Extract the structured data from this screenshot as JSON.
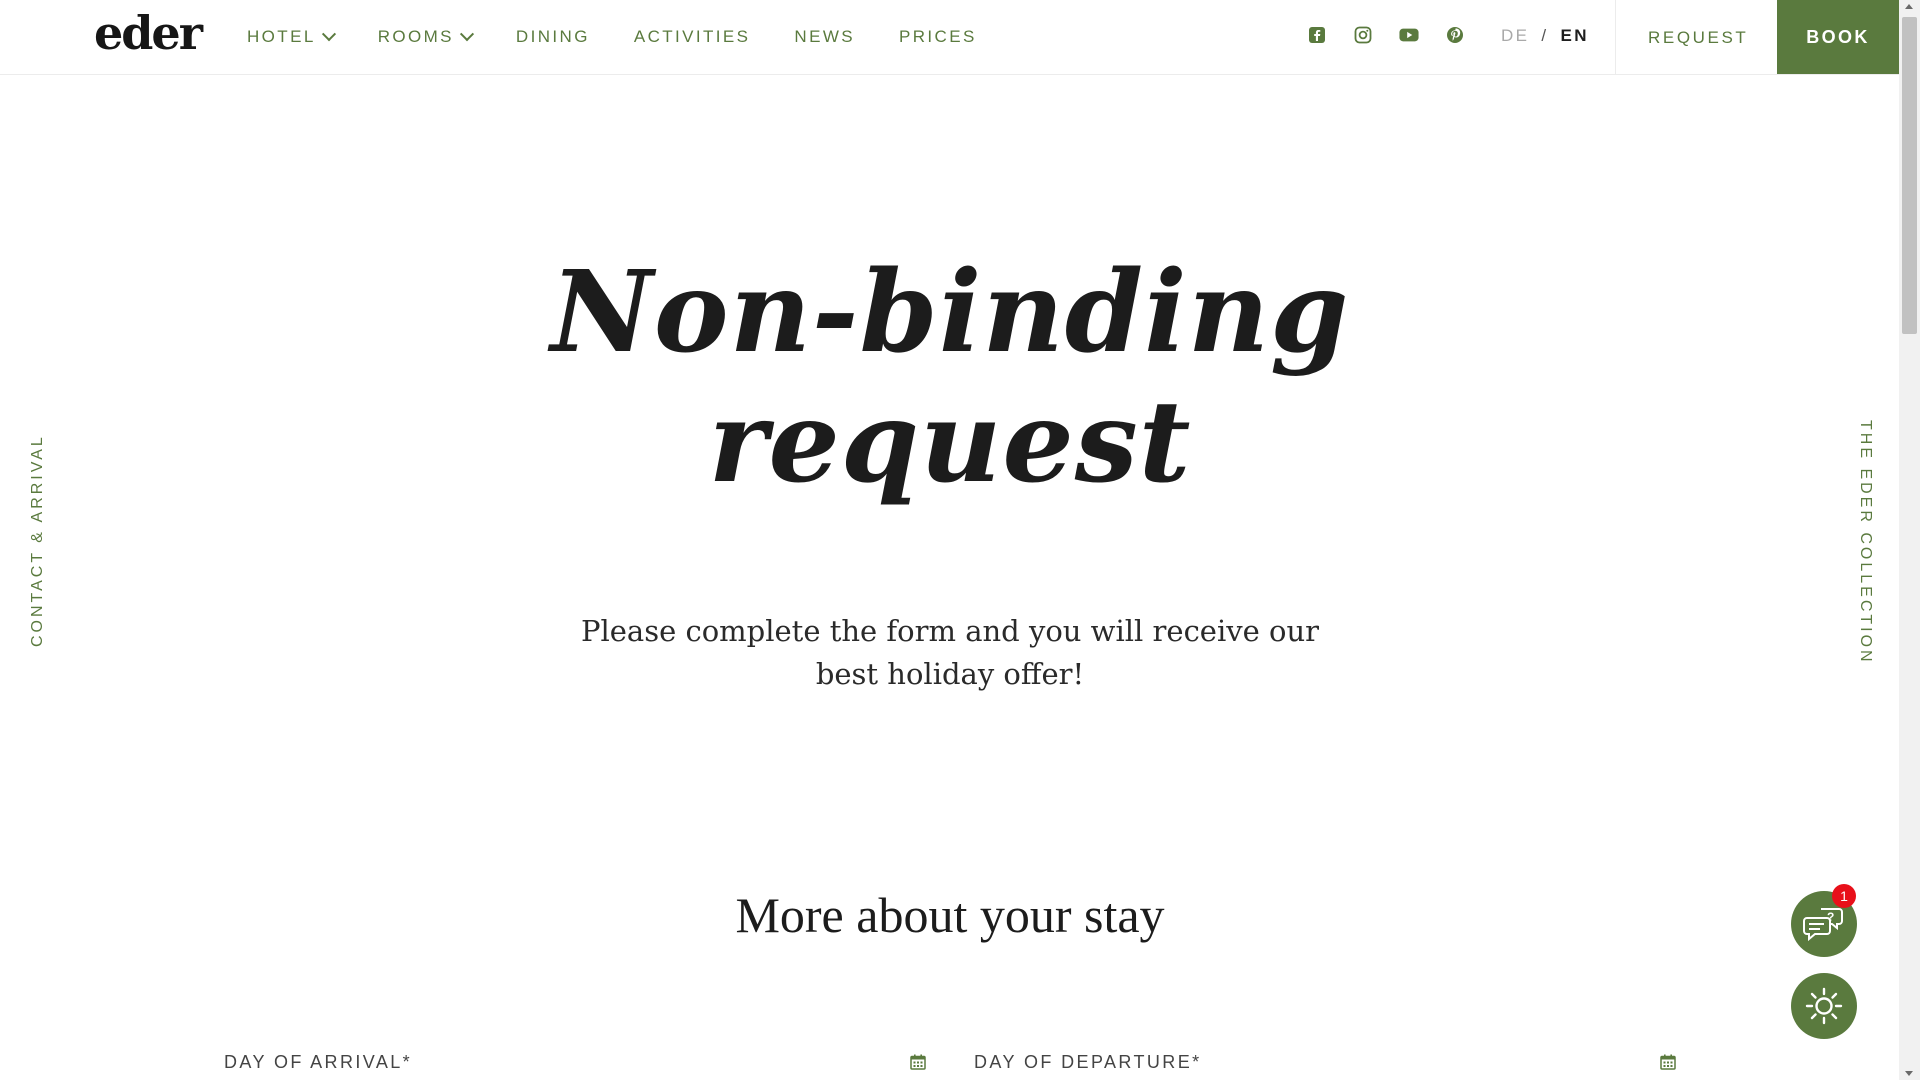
{
  "header": {
    "logo": "eder",
    "nav": [
      {
        "label": "HOTEL",
        "has_dropdown": true
      },
      {
        "label": "ROOMS",
        "has_dropdown": true
      },
      {
        "label": "DINING",
        "has_dropdown": false
      },
      {
        "label": "ACTIVITIES",
        "has_dropdown": false
      },
      {
        "label": "NEWS",
        "has_dropdown": false
      },
      {
        "label": "PRICES",
        "has_dropdown": false
      }
    ],
    "social_icons": [
      "facebook-icon",
      "instagram-icon",
      "youtube-icon",
      "pinterest-icon"
    ],
    "lang": {
      "de": "DE",
      "separator": "/",
      "en": "EN",
      "active": "EN"
    },
    "request_label": "REQUEST",
    "book_label": "BOOK"
  },
  "side": {
    "left_label": "CONTACT & ARRIVAL",
    "right_label": "THE EDER COLLECTION"
  },
  "hero": {
    "title_line1": "Non-binding",
    "title_line2": "request",
    "subtitle": "Please complete the form and you will receive our best holiday offer!"
  },
  "section": {
    "title": "More about your stay"
  },
  "form": {
    "arrival_label": "DAY OF ARRIVAL*",
    "departure_label": "DAY OF DEPARTURE*"
  },
  "widgets": {
    "chat_badge": "1",
    "chat_icon": "chat-help-icon",
    "theme_icon": "sun-icon"
  },
  "colors": {
    "accent": "#5a7a3e",
    "badge": "#e8101a",
    "text": "#1c1c1c"
  }
}
